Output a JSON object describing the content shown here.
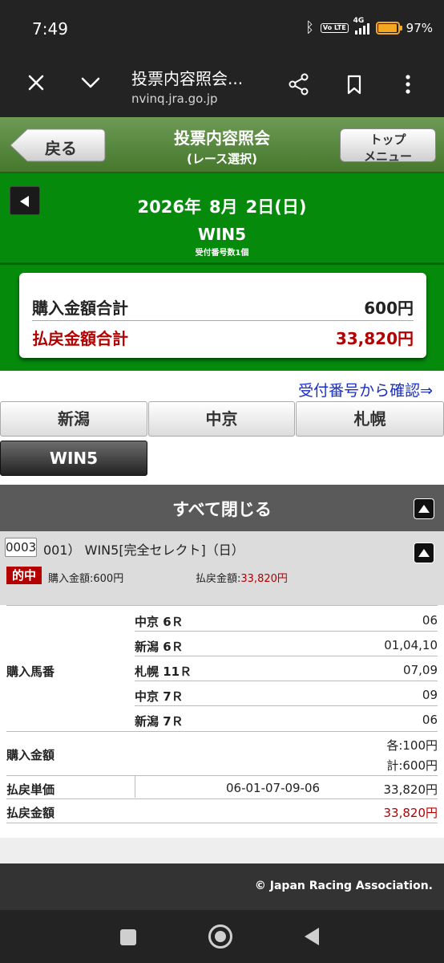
{
  "status_bar": {
    "time": "7:49",
    "network_label": "4G",
    "volte_label": "Vo LTE",
    "battery_percent": "97%",
    "battery_level": 0.97,
    "icons": [
      "bluetooth-icon",
      "volte-icon",
      "signal-icon",
      "battery-icon"
    ]
  },
  "browser": {
    "page_title": "投票内容照会...",
    "url": "nvinq.jra.go.jp",
    "icons": [
      "close-icon",
      "chevron-down-icon",
      "share-icon",
      "bookmark-icon",
      "more-icon"
    ]
  },
  "header": {
    "back_label": "戻る",
    "title_line1": "投票内容照会",
    "title_line2": "(レース選択)",
    "top_menu_line1": "トップ",
    "top_menu_line2": "メニュー"
  },
  "date_band": {
    "year": "2026年",
    "month": "8月",
    "day": "2日(日)",
    "bet_type": "WIN5",
    "receipt_count": "受付番号数1個"
  },
  "totals": {
    "purchase_label": "購入金額合計",
    "purchase_value": "600円",
    "payout_label": "払戻金額合計",
    "payout_value": "33,820円"
  },
  "receipt_link": "受付番号から確認⇒",
  "venue_tabs": [
    "新潟",
    "中京",
    "札幌",
    "WIN5"
  ],
  "close_all_label": "すべて閉じる",
  "bet": {
    "receipt_no": "0003",
    "name": "001） WIN5[完全セレクト]（日）",
    "hit_badge": "的中",
    "purchase_amount": "購入金額:600円",
    "payout_prefix": "払戻金額:",
    "payout_value": "33,820円"
  },
  "detail": {
    "horses_label": "購入馬番",
    "races": [
      {
        "race": "中京 6Ｒ",
        "horses": "06"
      },
      {
        "race": "新潟 6Ｒ",
        "horses": "01,04,10"
      },
      {
        "race": "札幌 11Ｒ",
        "horses": "07,09"
      },
      {
        "race": "中京 7Ｒ",
        "horses": "09"
      },
      {
        "race": "新潟 7Ｒ",
        "horses": "06"
      }
    ],
    "amount_label": "購入金額",
    "amount_each": "各:100円",
    "amount_total": "計:600円",
    "unit_label": "払戻単価",
    "unit_combo": "06-01-07-09-06",
    "unit_value": "33,820円",
    "payout_label": "払戻金額",
    "payout_value": "33,820円"
  },
  "footer": {
    "copyright": "© Japan Racing Association."
  },
  "colors": {
    "header_green": "#46782d",
    "band_green": "#058a0c",
    "payout_red": "#b40000",
    "link_blue": "#1a2fc9"
  }
}
